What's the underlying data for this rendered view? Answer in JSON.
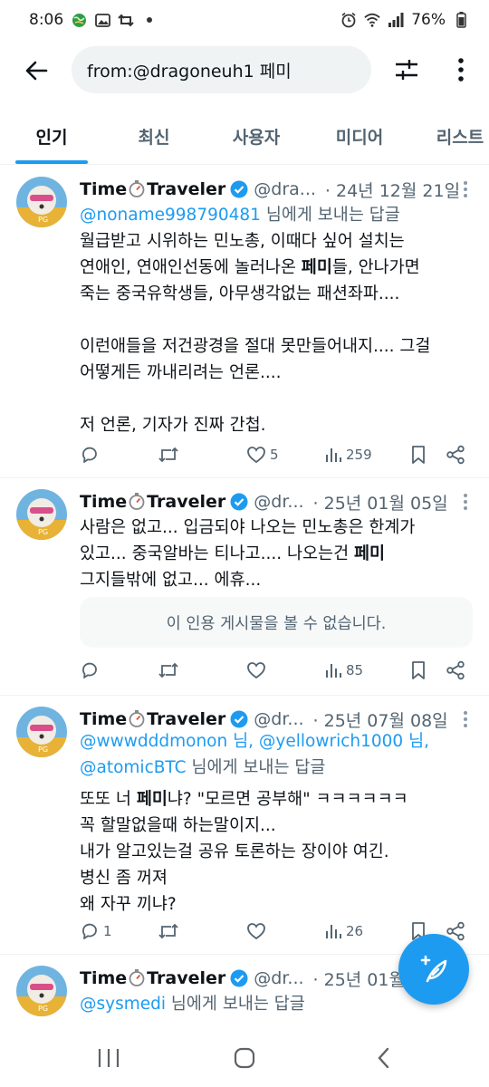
{
  "status_bar": {
    "time": "8:06",
    "battery": "76%"
  },
  "search": {
    "query": "from:@dragoneuh1 페미"
  },
  "tabs": [
    {
      "label": "인기"
    },
    {
      "label": "최신"
    },
    {
      "label": "사용자"
    },
    {
      "label": "미디어"
    },
    {
      "label": "리스트"
    }
  ],
  "colors": {
    "accent": "#1d9bf0",
    "secondary_text": "#536471",
    "primary_text": "#0f1419"
  },
  "tweets": [
    {
      "name_a": "Time",
      "name_b": "Traveler",
      "handle": "@dra...",
      "date": "· 24년 12월 21일",
      "reply_mention": "@noname998790481",
      "reply_suffix": " 님에게 보내는 답글",
      "line1": "월급받고 시위하는 민노총, 이때다 싶어 설치는",
      "line2a": "연애인, 연애인선동에 놀러나온 ",
      "keyword": "페미",
      "line2b": "들, 안나가면",
      "line3": "죽는 중국유학생들, 아무생각없는 패션좌파....",
      "line4": "이런애들을 저건광경을 절대 못만들어내지.... 그걸",
      "line5": "어떻게든 까내리려는 언론....",
      "line6": "저 언론, 기자가 진짜 간첩.",
      "replies": "",
      "retweets": "",
      "likes": "5",
      "views": "259"
    },
    {
      "name_a": "Time",
      "name_b": "Traveler",
      "handle": "@dr...",
      "date": "· 25년 01월 05일",
      "line1": "사람은 없고... 입금되야 나오는 민노총은 한계가",
      "line2a": "있고... 중국알바는 티나고.... 나오는건 ",
      "keyword": "페미",
      "line3": "그지들밖에 없고... 에휴...",
      "quote_unavailable": "이 인용 게시물을 볼 수 없습니다.",
      "replies": "",
      "retweets": "",
      "likes": "",
      "views": "85"
    },
    {
      "name_a": "Time",
      "name_b": "Traveler",
      "handle": "@dr...",
      "date": "· 25년 07월 08일",
      "mention1": "@wwwdddmonon 님, ",
      "mention2": "@yellowrich1000 님,",
      "mention3": "@atomicBTC",
      "reply_suffix": " 님에게 보내는 답글",
      "line1a": "또또 너 ",
      "keyword": "페미",
      "line1b": "냐? \"모르면 공부해\" ㅋㅋㅋㅋㅋㅋ",
      "line2": "꼭 할말없을때 하는말이지...",
      "line3": "내가 알고있는걸 공유 토론하는 장이야 여긴.",
      "line4": "병신 좀 꺼져",
      "line5": "왜 자꾸 끼냐?",
      "replies": "1",
      "retweets": "",
      "likes": "",
      "views": "26"
    },
    {
      "name_a": "Time",
      "name_b": "Traveler",
      "handle": "@dr...",
      "date": "· 25년 01월",
      "reply_mention": "@sysmedi",
      "reply_suffix": " 님에게 보내는 답글"
    }
  ]
}
